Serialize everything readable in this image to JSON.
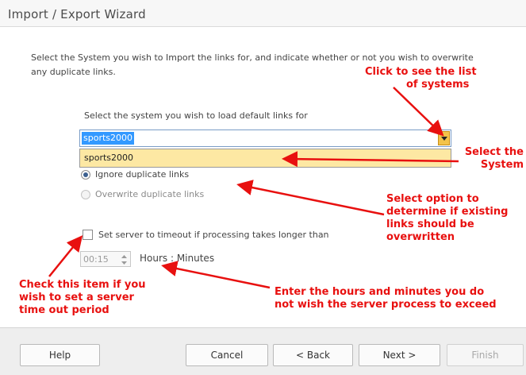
{
  "window": {
    "title": "Import / Export Wizard"
  },
  "intro_text": "Select the System you wish to Import the links for, and indicate whether or not you wish to overwrite any duplicate links.",
  "system_select": {
    "label": "Select the system you wish to load default links for",
    "value": "sports2000",
    "options": [
      "sports2000"
    ]
  },
  "duplicate_options": {
    "ignore_label": "Ignore duplicate links",
    "overwrite_label": "Overwrite duplicate links",
    "selected": "ignore"
  },
  "timeout": {
    "checkbox_label": "Set server to timeout if processing takes longer than",
    "checked": false,
    "value": "00:15",
    "unit_label": "Hours : Minutes"
  },
  "annotations": {
    "click_list_1": "Click to see the list",
    "click_list_2": "of systems",
    "select_system_1": "Select the",
    "select_system_2": "System",
    "option_1": "Select option to",
    "option_2": "determine if existing",
    "option_3": "links should be",
    "option_4": "overwritten",
    "check_1": "Check this item if you",
    "check_2": "wish to set a server",
    "check_3": "time out period",
    "enter_1": "Enter the hours and minutes you do",
    "enter_2": "not wish the server process to exceed"
  },
  "buttons": {
    "help": "Help",
    "cancel": "Cancel",
    "back": "< Back",
    "next": "Next >",
    "finish": "Finish"
  },
  "colors": {
    "annotation_red": "#e8100f",
    "selection_blue": "#3399ff",
    "dropdown_highlight": "#fde8a3"
  }
}
